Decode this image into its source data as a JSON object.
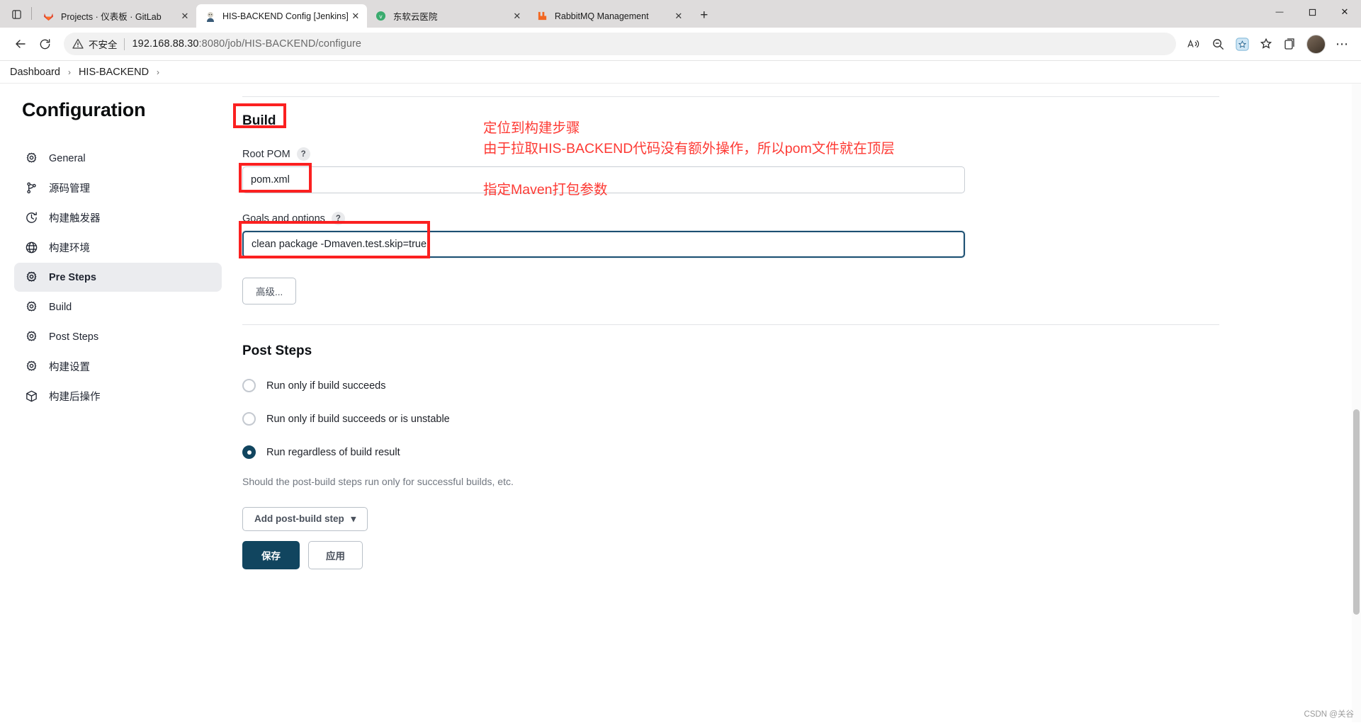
{
  "browser": {
    "tabs": [
      {
        "title": "Projects · 仪表板 · GitLab",
        "favicon": "gitlab-icon",
        "active": false
      },
      {
        "title": "HIS-BACKEND Config [Jenkins]",
        "favicon": "jenkins-icon",
        "active": true
      },
      {
        "title": "东软云医院",
        "favicon": "v-circle-icon",
        "active": false
      },
      {
        "title": "RabbitMQ Management",
        "favicon": "rabbitmq-icon",
        "active": false
      }
    ],
    "new_tab_label": "+",
    "window_controls": {
      "minimize": "—",
      "maximize": "❐",
      "close": "✕"
    },
    "toolbar": {
      "back": "←",
      "reload": "⟳",
      "insecure_label": "不安全",
      "url_host": "192.168.88.30",
      "url_rest": ":8080/job/HIS-BACKEND/configure",
      "read_aloud": "Aᴺ",
      "zoom_out": "zoom-out-icon",
      "add_favorite": "add-favorite-icon",
      "favorites": "favorites-icon",
      "collections": "collections-icon",
      "settings_more": "⋯"
    }
  },
  "breadcrumb": {
    "items": [
      "Dashboard",
      "HIS-BACKEND"
    ],
    "separator": "›"
  },
  "sidebar": {
    "title": "Configuration",
    "items": [
      {
        "label": "General",
        "icon": "gear-icon",
        "active": false
      },
      {
        "label": "源码管理",
        "icon": "branch-icon",
        "active": false
      },
      {
        "label": "构建触发器",
        "icon": "clock-icon",
        "active": false
      },
      {
        "label": "构建环境",
        "icon": "globe-icon",
        "active": false
      },
      {
        "label": "Pre Steps",
        "icon": "gear-icon",
        "active": true
      },
      {
        "label": "Build",
        "icon": "gear-icon",
        "active": false
      },
      {
        "label": "Post Steps",
        "icon": "gear-icon",
        "active": false
      },
      {
        "label": "构建设置",
        "icon": "gear-icon",
        "active": false
      },
      {
        "label": "构建后操作",
        "icon": "box-icon",
        "active": false
      }
    ]
  },
  "main": {
    "build_section": {
      "heading": "Build",
      "root_pom": {
        "label": "Root POM",
        "help": "?",
        "value": "pom.xml"
      },
      "goals": {
        "label": "Goals and options",
        "help": "?",
        "value": "clean package -Dmaven.test.skip=true"
      },
      "advanced_button": "高级..."
    },
    "post_steps_section": {
      "heading": "Post Steps",
      "options": [
        {
          "label": "Run only if build succeeds",
          "checked": false
        },
        {
          "label": "Run only if build succeeds or is unstable",
          "checked": false
        },
        {
          "label": "Run regardless of build result",
          "checked": true
        }
      ],
      "hint": "Should the post-build steps run only for successful builds, etc.",
      "add_step_button": "Add post-build step",
      "add_step_caret": "▾"
    },
    "actions": {
      "save": "保存",
      "apply": "应用"
    }
  },
  "annotations": [
    {
      "text": "定位到构建步骤"
    },
    {
      "text": "由于拉取HIS-BACKEND代码没有额外操作，所以pom文件就在顶层"
    },
    {
      "text": "指定Maven打包参数"
    }
  ],
  "watermark": "CSDN @关谷",
  "colors": {
    "accent": "#11455f",
    "annotation_red": "#fd3a34",
    "redbox": "#fb2020",
    "sidebar_active_bg": "#ebecef"
  }
}
